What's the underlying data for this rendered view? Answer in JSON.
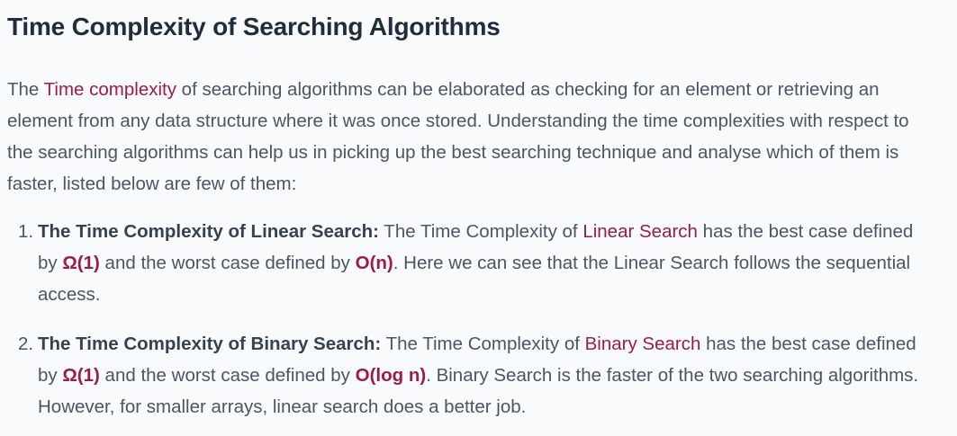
{
  "article": {
    "title": "Time Complexity of Searching Algorithms",
    "intro": {
      "prefix": "The ",
      "link": "Time complexity",
      "rest": " of searching algorithms can be elaborated as checking for an element or retrieving an element from any data structure where it was once stored. Understanding the time complexities with respect to the searching algorithms can help us in picking up the best searching technique and analyse which of them is faster, listed below are few of them:"
    },
    "items": [
      {
        "number": "1.",
        "heading": "The Time Complexity of Linear Search:",
        "text_a": " The Time Complexity of ",
        "link": "Linear Search",
        "text_b": " has the best case defined by ",
        "best": "Ω(1)",
        "text_c": " and the worst case defined by ",
        "worst": "O(n)",
        "text_d": ". Here we can see that the Linear Search follows the sequential access."
      },
      {
        "number": "2.",
        "heading": "The Time Complexity of Binary Search:",
        "text_a": " The Time Complexity of ",
        "link": "Binary Search",
        "text_b": " has the best case defined by ",
        "best": "Ω(1)",
        "text_c": " and the worst case defined by ",
        "worst": "O(log n)",
        "text_d": ". Binary Search is the faster of the two searching algorithms. However, for smaller arrays, linear search does a better job."
      }
    ]
  },
  "colors": {
    "background": "#f9fafb",
    "title": "#1f2d3d",
    "body_text": "#4b5563",
    "link": "#9b1b4a"
  }
}
